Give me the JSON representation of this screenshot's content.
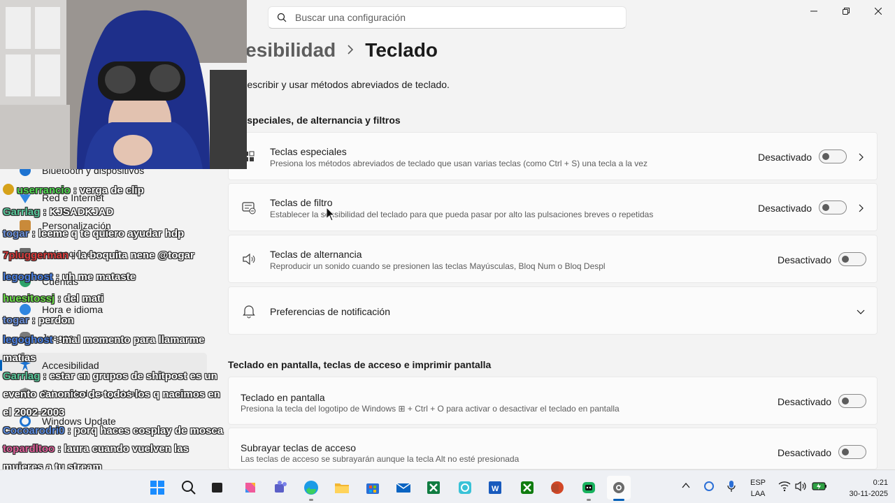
{
  "search": {
    "placeholder": "Buscar una configuración"
  },
  "window_controls": [
    "minimize",
    "restore",
    "close"
  ],
  "nav": {
    "items": [
      {
        "label": "Bluetooth y dispositivos",
        "icon": "bluetooth-icon"
      },
      {
        "label": "Red e Internet",
        "icon": "wifi-icon"
      },
      {
        "label": "Personalización",
        "icon": "brush-icon"
      },
      {
        "label": "Aplicaciones",
        "icon": "apps-icon"
      },
      {
        "label": "Cuentas",
        "icon": "person-icon"
      },
      {
        "label": "Hora e idioma",
        "icon": "globe-clock-icon"
      },
      {
        "label": "Juegos",
        "icon": "gamepad-icon"
      },
      {
        "label": "Accesibilidad",
        "icon": "accessibility-icon",
        "active": true
      },
      {
        "label": "Privacidad y seguridad",
        "icon": "shield-icon"
      },
      {
        "label": "Windows Update",
        "icon": "update-icon"
      }
    ]
  },
  "breadcrumb": {
    "parent": "ccesibilidad",
    "current": "Teclado"
  },
  "description": "ita el escribir y usar métodos abreviados de teclado.",
  "sections": [
    {
      "title": "as especiales, de alternancia y filtros",
      "cards": [
        {
          "title": "Teclas especiales",
          "subtitle": "Presiona los métodos abreviados de teclado que usan varias teclas (como Ctrl + S) una tecla a la vez",
          "state": "Desactivado",
          "icon": "sticky-keys-icon"
        },
        {
          "title": "Teclas de filtro",
          "subtitle": "Establecer la sensibilidad del teclado para que pueda pasar por alto las pulsaciones breves o repetidas",
          "state": "Desactivado",
          "icon": "filter-keys-icon"
        },
        {
          "title": "Teclas de alternancia",
          "subtitle": "Reproducir un sonido cuando se presionen las teclas Mayúsculas, Bloq Num o Bloq Despl",
          "state": "Desactivado",
          "icon": "speaker-icon"
        },
        {
          "title": "Preferencias de notificación",
          "icon": "bell-icon"
        }
      ]
    },
    {
      "title": "Teclado en pantalla, teclas de acceso e imprimir pantalla",
      "cards": [
        {
          "title": "Teclado en pantalla",
          "subtitle": "Presiona la tecla del logotipo de Windows ⊞ + Ctrl + O para activar o desactivar el teclado en pantalla",
          "state": "Desactivado"
        },
        {
          "title": "Subrayar teclas de acceso",
          "subtitle": "Las teclas de acceso se subrayarán aunque la tecla Alt no esté presionada",
          "state": "Desactivado"
        }
      ]
    }
  ],
  "chat": [
    {
      "user": "userrancio",
      "color": "#4fd84f",
      "text": " : verga de clip"
    },
    {
      "user": "Garrlag",
      "color": "#58c79a",
      "text": " : KJSADKJAD"
    },
    {
      "user": "togar",
      "color": "#6a8fd8",
      "text": " : leeme q te quiero ayudar hdp"
    },
    {
      "user": "7pluggerman",
      "color": "#d83a3a",
      "text": " : la boquita nene @togar"
    },
    {
      "user": "legoghost",
      "color": "#4a7fe0",
      "text": " : uh me mataste"
    },
    {
      "user": "huesitossj",
      "color": "#6ee04a",
      "text": " : del mati"
    },
    {
      "user": "togar",
      "color": "#6a8fd8",
      "text": " : perdon"
    },
    {
      "user": "legoghost",
      "color": "#4a7fe0",
      "text": " : mal momento para llamarme matias"
    },
    {
      "user": "Garrlag",
      "color": "#58c79a",
      "text": " : estar en grupos de shitpost es un evento canonico de todos los q nacimos en el 2002-2003"
    },
    {
      "user": "Cocoarodri0",
      "color": "#5a8be0",
      "text": " : porq haces cosplay de mosca"
    },
    {
      "user": "topardltoo",
      "color": "#e0609a",
      "text": " : laura cuando vuelven las mujeres a tu stream"
    }
  ],
  "taskbar": {
    "apps": [
      "start-icon",
      "search-icon",
      "task-view-icon",
      "copilot-icon",
      "teams-icon",
      "edge-icon",
      "file-explorer-icon",
      "store-icon",
      "mail-icon",
      "excel-icon",
      "copilot-app-icon",
      "word-icon",
      "xbox-icon",
      "powerpoint-icon",
      "game-app-icon",
      "settings-icon"
    ],
    "lang_top": "ESP",
    "lang_bottom": "LAA",
    "time": "0:21",
    "date": "30-11-2025"
  },
  "colors": {
    "accent": "#005fb8",
    "background": "#f3f3f3",
    "card": "#fbfbfb"
  }
}
